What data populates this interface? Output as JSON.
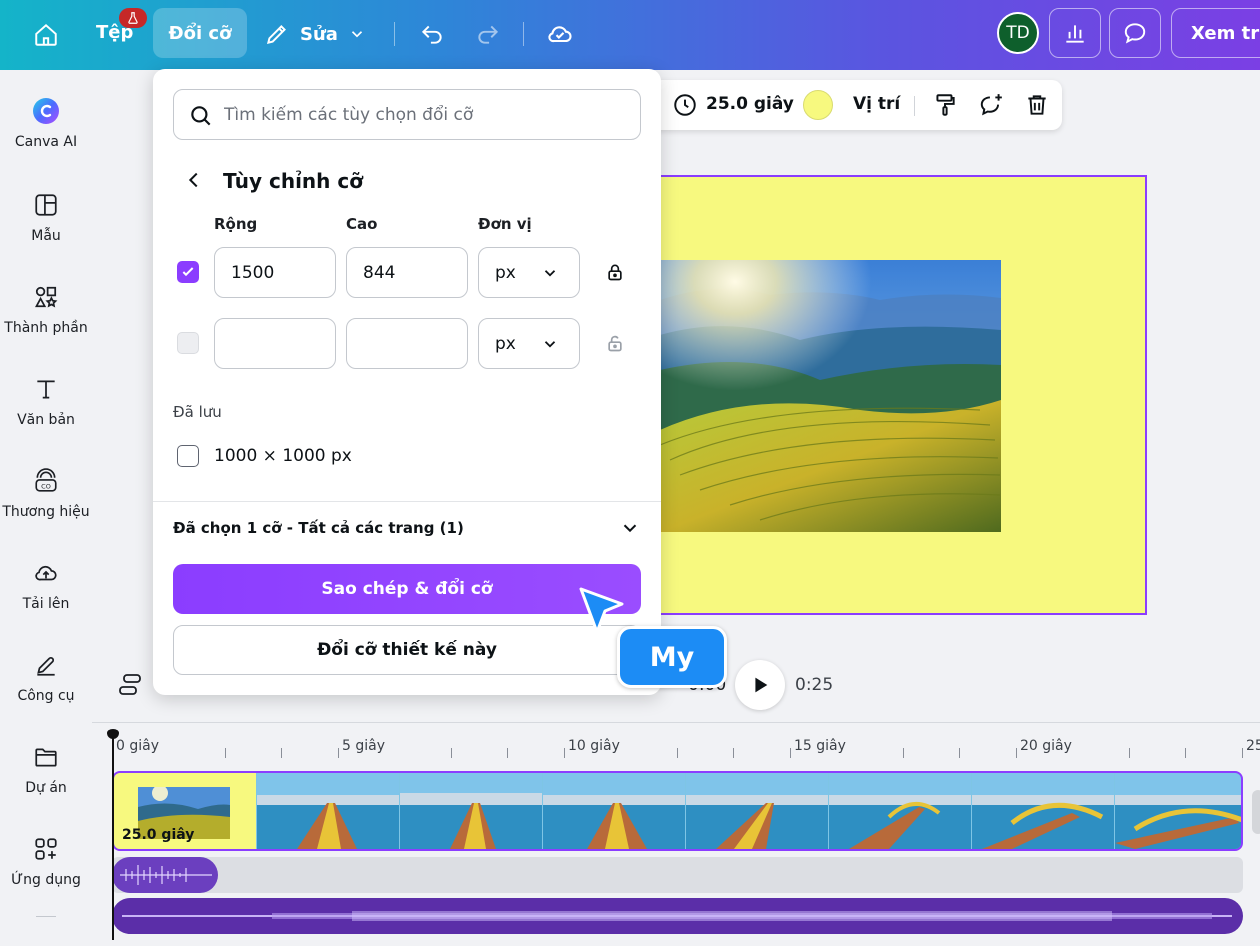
{
  "topbar": {
    "file_label": "Tệp",
    "resize_label": "Đổi cỡ",
    "edit_label": "Sửa",
    "avatar_initials": "TD",
    "view_label": "Xem trư",
    "badge_color": "#c62828"
  },
  "sidebar": {
    "items": [
      {
        "label": "Canva AI",
        "icon": "canva-ai-icon"
      },
      {
        "label": "Mẫu",
        "icon": "template-icon"
      },
      {
        "label": "Thành phần",
        "icon": "elements-icon"
      },
      {
        "label": "Văn bản",
        "icon": "text-icon"
      },
      {
        "label": "Thương hiệu",
        "icon": "brand-icon"
      },
      {
        "label": "Tải lên",
        "icon": "upload-icon"
      },
      {
        "label": "Công cụ",
        "icon": "tools-icon"
      },
      {
        "label": "Dự án",
        "icon": "folder-icon"
      },
      {
        "label": "Ứng dụng",
        "icon": "apps-icon"
      }
    ]
  },
  "float_toolbar": {
    "duration": "25.0 giây",
    "color": "#f7f97f",
    "position_label": "Vị trí"
  },
  "resize_panel": {
    "search_placeholder": "Tìm kiếm các tùy chọn đổi cỡ",
    "title": "Tùy chỉnh cỡ",
    "width_label": "Rộng",
    "height_label": "Cao",
    "unit_label": "Đơn vị",
    "row1": {
      "width": "1500",
      "height": "844",
      "unit": "px",
      "checked": true
    },
    "row2": {
      "width": "",
      "height": "",
      "unit": "px",
      "checked": false
    },
    "saved_label": "Đã lưu",
    "saved_item": "1000 × 1000 px",
    "selected_summary": "Đã chọn 1 cỡ - Tất cả các trang (1)",
    "primary_button": "Sao chép & đổi cỡ",
    "secondary_button": "Đổi cỡ thiết kế này"
  },
  "collaborator": {
    "name": "My",
    "color": "#1c8cf5"
  },
  "playback": {
    "current_time": "0:00",
    "total_time": "0:25"
  },
  "timeline": {
    "ticks": [
      "0 giây",
      "5 giây",
      "10 giây",
      "15 giây",
      "20 giây",
      "25"
    ],
    "first_clip_label": "25.0 giây"
  },
  "colors": {
    "accent": "#8b3dff",
    "canvas_bg": "#f7f97f"
  }
}
